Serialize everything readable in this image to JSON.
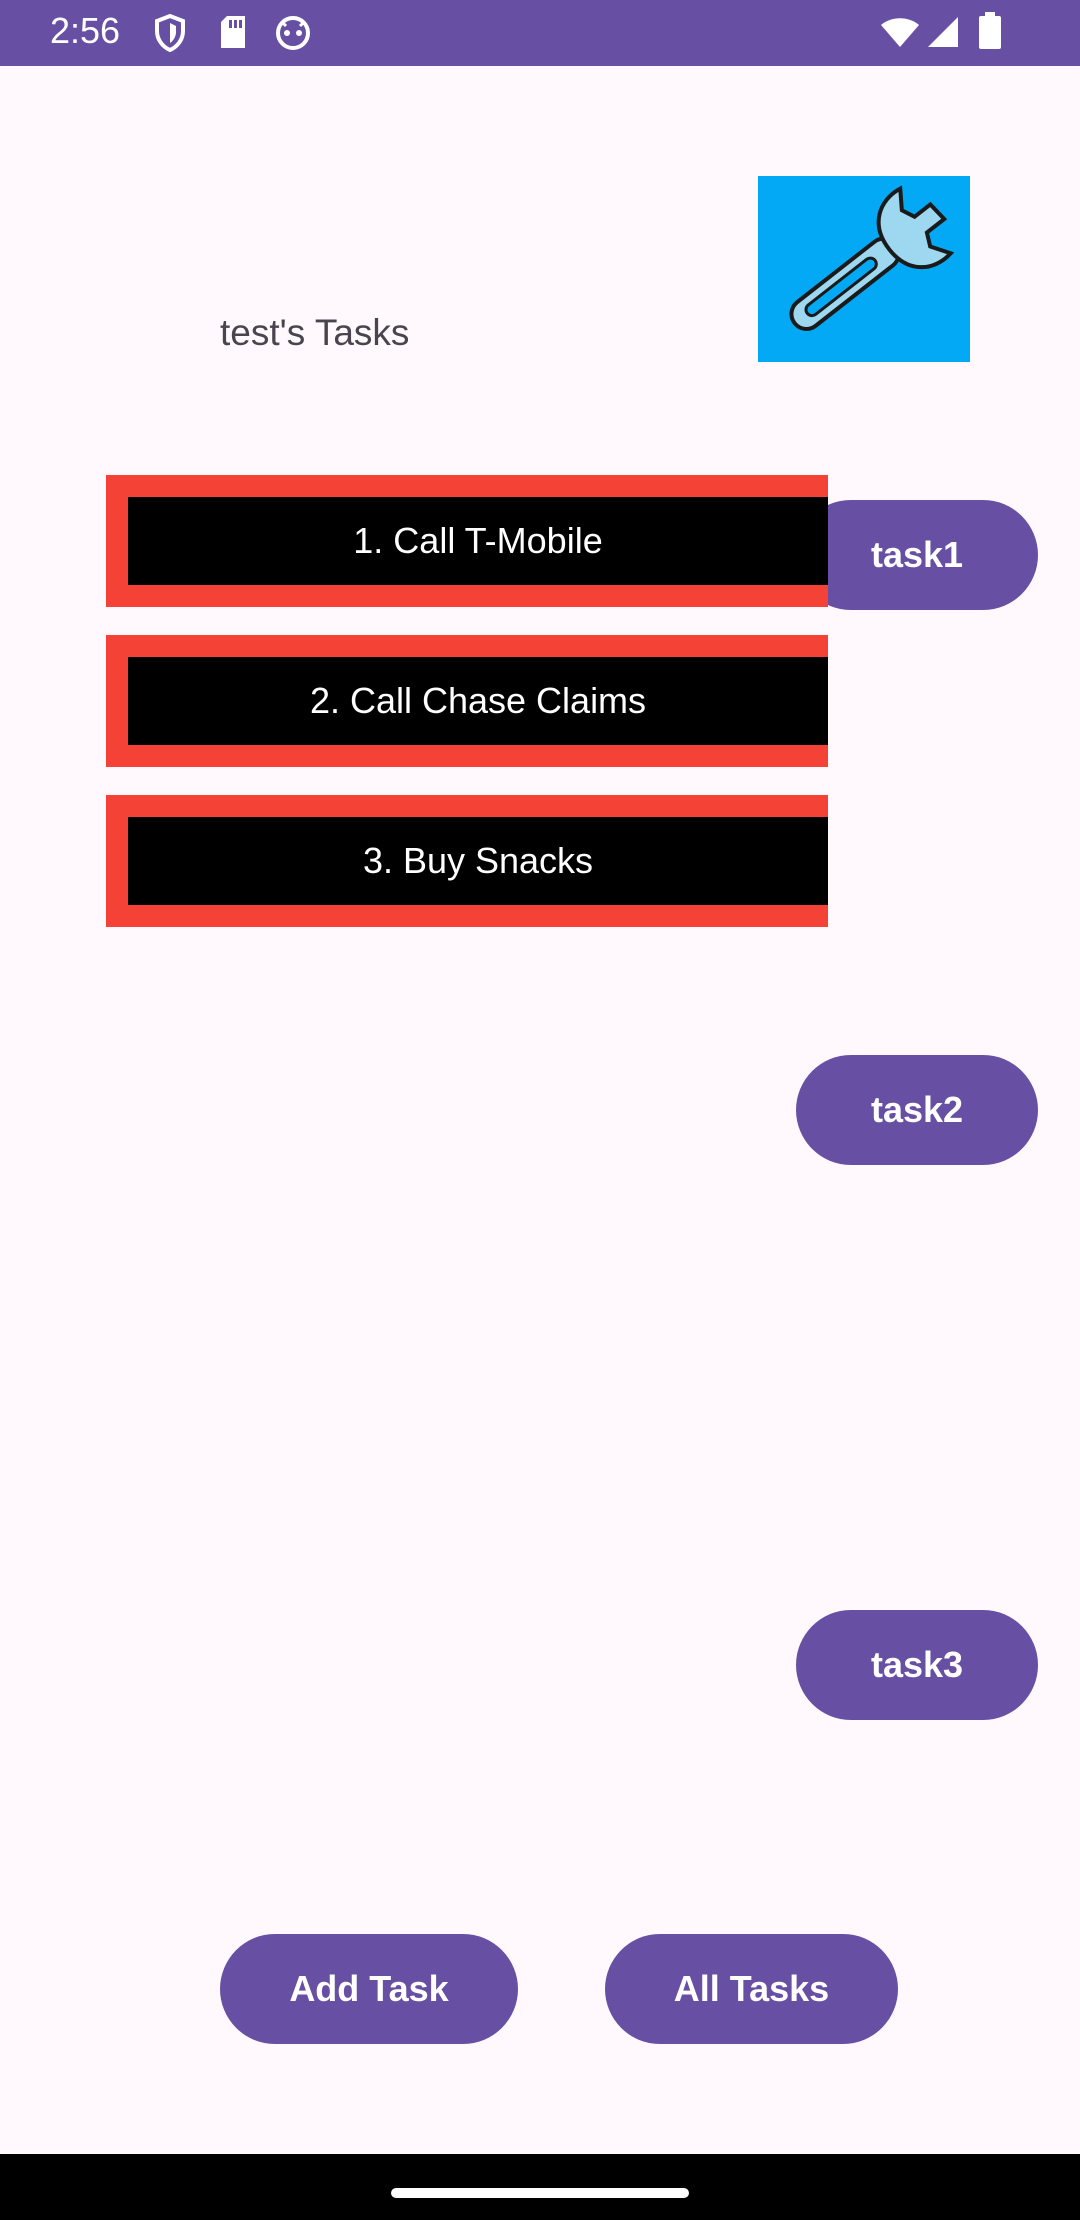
{
  "status_bar": {
    "time": "2:56",
    "left_icons": [
      "shield-icon",
      "sd-card-icon",
      "android-face-icon"
    ],
    "right_icons": [
      "wifi-icon",
      "signal-icon",
      "battery-icon"
    ],
    "background": "#6750A4"
  },
  "header": {
    "title": "test's Tasks",
    "image_icon": "wrench-icon"
  },
  "task_list": [
    {
      "label": "1. Call T-Mobile"
    },
    {
      "label": "2. Call Chase Claims"
    },
    {
      "label": "3. Buy Snacks"
    }
  ],
  "task_buttons": [
    {
      "label": "task1"
    },
    {
      "label": "task2"
    },
    {
      "label": "task3"
    }
  ],
  "bottom_actions": {
    "add_task": "Add Task",
    "all_tasks": "All Tasks"
  },
  "colors": {
    "accent": "#6750A4",
    "task_border": "#F44336",
    "task_fill": "#000000",
    "image_bg": "#03A9F4",
    "page_bg": "#FFF8FC"
  }
}
